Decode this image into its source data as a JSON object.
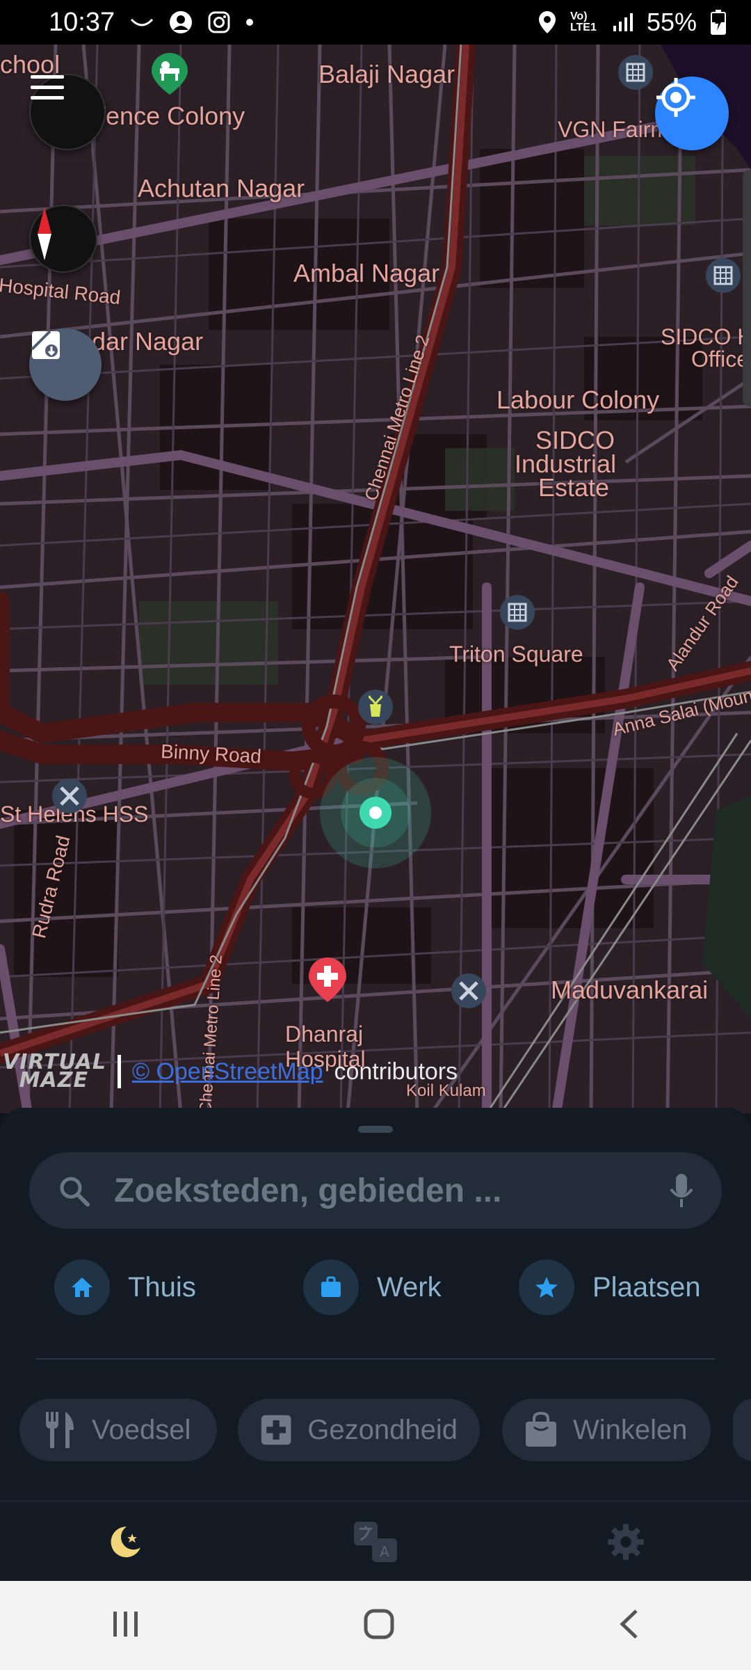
{
  "status_bar": {
    "time": "10:37",
    "battery": "55%",
    "network": "Vo) LTE1"
  },
  "map": {
    "labels": [
      "chool",
      "Balaji Nagar",
      "Defence Colony",
      "VGN Fairm",
      "Achutan Nagar",
      "Hospital Road",
      "Ambal Nagar",
      "dar Nagar",
      "SIDCO H",
      "Office",
      "Labour Colony",
      "SIDCO",
      "Industrial",
      "Estate",
      "Chennai Metro Line 2",
      "Alandur Road",
      "Triton Square",
      "Anna Salai (Mount",
      "Binny Road",
      "St Helens HSS",
      "Rudra Road",
      "Maduvankarai",
      "Chennai Metro Line 2",
      "Dhanraj",
      "Hospital",
      "Koil Kulam"
    ],
    "attribution": {
      "brand_line1": "VIRTUAL",
      "brand_line2": "MAZE",
      "link": "© OpenStreetMap",
      "contributors": "contributors"
    }
  },
  "search": {
    "placeholder": "Zoeksteden, gebieden ..."
  },
  "quick_places": [
    {
      "label": "Thuis",
      "icon": "home-icon"
    },
    {
      "label": "Werk",
      "icon": "briefcase-icon"
    },
    {
      "label": "Plaatsen",
      "icon": "star-icon"
    }
  ],
  "categories": [
    {
      "label": "Voedsel",
      "icon": "fork-knife-icon"
    },
    {
      "label": "Gezondheid",
      "icon": "medical-cross-icon"
    },
    {
      "label": "Winkelen",
      "icon": "shopping-bag-icon"
    }
  ],
  "bottom_nav": [
    "night-mode-icon",
    "translate-icon",
    "settings-icon"
  ],
  "colors": {
    "accent_blue": "#2d86ff",
    "map_label": "#e6a59c",
    "road": "#6a4f6d",
    "main_road": "#5a1e1e",
    "location_dot": "#3fd9b0",
    "hospital_marker": "#e8404f",
    "sheet_bg": "#121a23"
  }
}
